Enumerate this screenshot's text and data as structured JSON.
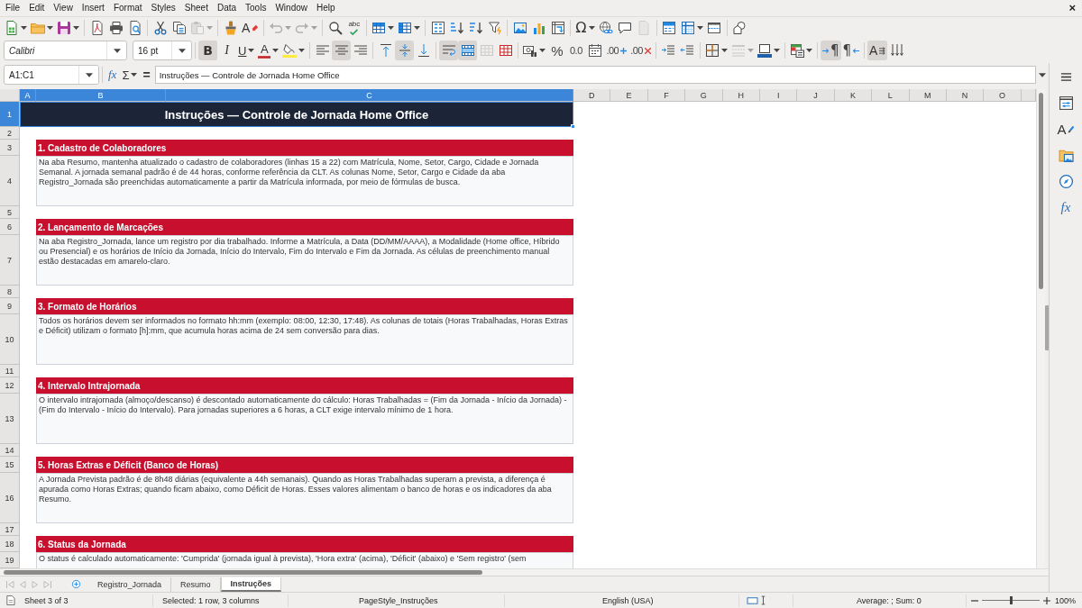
{
  "menu_bar": {
    "items": [
      "File",
      "Edit",
      "View",
      "Insert",
      "Format",
      "Styles",
      "Sheet",
      "Data",
      "Tools",
      "Window",
      "Help"
    ],
    "close_glyph": "×"
  },
  "standard_toolbar": {
    "groups": [
      [
        {
          "dropdown": true,
          "disabled": false
        },
        {
          "dropdown": true,
          "disabled": false
        },
        {
          "dropdown": true,
          "disabled": false
        }
      ],
      [
        {
          "dropdown": false,
          "disabled": false
        },
        {
          "dropdown": false,
          "disabled": false
        },
        {
          "dropdown": false,
          "disabled": false
        }
      ],
      [
        {
          "dropdown": false,
          "disabled": false
        },
        {
          "dropdown": false,
          "disabled": false
        },
        {
          "dropdown": true,
          "disabled": true
        }
      ],
      [
        {
          "dropdown": false,
          "disabled": false
        },
        {
          "glyph": "A",
          "dropdown": false,
          "disabled": false
        }
      ],
      [
        {
          "dropdown": true,
          "disabled": true
        },
        {
          "dropdown": true,
          "disabled": true
        }
      ],
      [
        {
          "dropdown": false,
          "disabled": false
        },
        {
          "glyph": "abc",
          "dropdown": false,
          "disabled": false
        }
      ],
      [
        {
          "dropdown": true,
          "disabled": false
        },
        {
          "dropdown": true,
          "disabled": false
        }
      ],
      [
        {
          "dropdown": false,
          "disabled": false
        },
        {
          "dropdown": false,
          "disabled": false
        },
        {
          "dropdown": false,
          "disabled": false
        },
        {
          "dropdown": false,
          "disabled": false
        }
      ],
      [
        {
          "dropdown": false,
          "disabled": false
        },
        {
          "dropdown": false,
          "disabled": false
        },
        {
          "dropdown": false,
          "disabled": false
        }
      ],
      [
        {
          "glyph": "Ω",
          "dropdown": true,
          "disabled": false
        },
        {
          "dropdown": false,
          "disabled": false
        },
        {
          "dropdown": false,
          "disabled": false
        },
        {
          "dropdown": false,
          "disabled": true
        }
      ],
      [
        {
          "dropdown": false,
          "disabled": false
        },
        {
          "dropdown": true,
          "disabled": false
        },
        {
          "dropdown": false,
          "disabled": false
        }
      ],
      [
        {
          "dropdown": false,
          "disabled": false
        }
      ]
    ]
  },
  "formatting_toolbar": {
    "font_name": "Calibri",
    "font_size": "16 pt",
    "groups": [
      [
        {
          "glyph": "B",
          "pressed": true,
          "dropdown": false,
          "disabled": false
        },
        {
          "glyph": "I",
          "pressed": false,
          "dropdown": false,
          "disabled": false
        },
        {
          "glyph": "U",
          "pressed": false,
          "dropdown": true,
          "disabled": false
        },
        {
          "glyph": "A",
          "pressed": false,
          "dropdown": true,
          "disabled": false
        },
        {
          "pressed": false,
          "dropdown": true,
          "disabled": false
        }
      ],
      [
        {
          "pressed": false,
          "dropdown": false,
          "disabled": false
        },
        {
          "pressed": true,
          "dropdown": false,
          "disabled": false
        },
        {
          "pressed": false,
          "dropdown": false,
          "disabled": false
        }
      ],
      [
        {
          "pressed": false,
          "dropdown": false,
          "disabled": false
        },
        {
          "pressed": true,
          "dropdown": false,
          "disabled": false
        },
        {
          "pressed": false,
          "dropdown": false,
          "disabled": false
        }
      ],
      [
        {
          "pressed": true,
          "dropdown": false,
          "disabled": false
        },
        {
          "pressed": true,
          "dropdown": false,
          "disabled": false
        },
        {
          "pressed": false,
          "dropdown": false,
          "disabled": true
        },
        {
          "pressed": false,
          "dropdown": false,
          "disabled": false
        }
      ],
      [
        {
          "pressed": false,
          "dropdown": true,
          "disabled": false
        },
        {
          "glyph": "%",
          "pressed": false,
          "dropdown": false,
          "disabled": false
        },
        {
          "glyph": "0.0",
          "pressed": false,
          "dropdown": false,
          "disabled": false
        },
        {
          "pressed": false,
          "dropdown": false,
          "disabled": false
        },
        {
          "glyph": ".00",
          "pressed": false,
          "dropdown": false,
          "disabled": false
        },
        {
          "glyph": ".00",
          "pressed": false,
          "dropdown": false,
          "disabled": false
        }
      ],
      [
        {
          "pressed": false,
          "dropdown": false,
          "disabled": false
        },
        {
          "pressed": false,
          "dropdown": false,
          "disabled": false
        }
      ],
      [
        {
          "pressed": false,
          "dropdown": true,
          "disabled": false
        },
        {
          "pressed": false,
          "dropdown": true,
          "disabled": true
        },
        {
          "pressed": false,
          "dropdown": true,
          "disabled": false
        }
      ],
      [
        {
          "pressed": false,
          "dropdown": true,
          "disabled": false
        }
      ],
      [
        {
          "glyph": "¶",
          "pressed": true,
          "dropdown": false,
          "disabled": false
        },
        {
          "glyph": "¶",
          "pressed": false,
          "dropdown": false,
          "disabled": false
        }
      ],
      [
        {
          "glyph": "A",
          "pressed": true,
          "dropdown": false,
          "disabled": false
        },
        {
          "pressed": false,
          "dropdown": false,
          "disabled": false
        }
      ]
    ]
  },
  "formula_bar": {
    "name_box": "A1:C1",
    "function_glyph": "fx",
    "sum_glyph": "Σ",
    "equals_glyph": "=",
    "content": "Instruções — Controle de Jornada Home Office"
  },
  "sidebar": {
    "styles_glyph": "A",
    "functions_glyph": "fx"
  },
  "sheet": {
    "columns": [
      {
        "label": "A",
        "selected": true
      },
      {
        "label": "B",
        "selected": true
      },
      {
        "label": "C",
        "selected": true
      },
      {
        "label": "D",
        "selected": false
      },
      {
        "label": "E",
        "selected": false
      },
      {
        "label": "F",
        "selected": false
      },
      {
        "label": "G",
        "selected": false
      },
      {
        "label": "H",
        "selected": false
      },
      {
        "label": "I",
        "selected": false
      },
      {
        "label": "J",
        "selected": false
      },
      {
        "label": "K",
        "selected": false
      },
      {
        "label": "L",
        "selected": false
      },
      {
        "label": "M",
        "selected": false
      },
      {
        "label": "N",
        "selected": false
      },
      {
        "label": "O",
        "selected": false
      }
    ],
    "rows": [
      {
        "number": "1",
        "selected": true,
        "kind": "title",
        "text": "Instruções — Controle de Jornada Home Office"
      },
      {
        "number": "2",
        "selected": false,
        "kind": "blank"
      },
      {
        "number": "3",
        "selected": false,
        "kind": "heading",
        "text": "1. Cadastro de Colaboradores"
      },
      {
        "number": "4",
        "selected": false,
        "kind": "body",
        "text": "Na aba Resumo, mantenha atualizado o cadastro de colaboradores (linhas 15 a 22) com Matrícula, Nome, Setor, Cargo, Cidade e Jornada Semanal. A jornada semanal padrão é de 44 horas, conforme referência da CLT. As colunas Nome, Setor, Cargo e Cidade da aba Registro_Jornada são preenchidas automaticamente a partir da Matrícula informada, por meio de fórmulas de busca."
      },
      {
        "number": "5",
        "selected": false,
        "kind": "blank"
      },
      {
        "number": "6",
        "selected": false,
        "kind": "heading",
        "text": "2. Lançamento de Marcações"
      },
      {
        "number": "7",
        "selected": false,
        "kind": "body",
        "text": "Na aba Registro_Jornada, lance um registro por dia trabalhado. Informe a Matrícula, a Data (DD/MM/AAAA), a Modalidade (Home office, Híbrido ou Presencial) e os horários de Início da Jornada, Início do Intervalo, Fim do Intervalo e Fim da Jornada. As células de preenchimento manual estão destacadas em amarelo-claro."
      },
      {
        "number": "8",
        "selected": false,
        "kind": "blank"
      },
      {
        "number": "9",
        "selected": false,
        "kind": "heading",
        "text": "3. Formato de Horários"
      },
      {
        "number": "10",
        "selected": false,
        "kind": "body",
        "text": "Todos os horários devem ser informados no formato hh:mm (exemplo: 08:00, 12:30, 17:48). As colunas de totais (Horas Trabalhadas, Horas Extras e Déficit) utilizam o formato [h]:mm, que acumula horas acima de 24 sem conversão para dias."
      },
      {
        "number": "11",
        "selected": false,
        "kind": "blank"
      },
      {
        "number": "12",
        "selected": false,
        "kind": "heading",
        "text": "4. Intervalo Intrajornada"
      },
      {
        "number": "13",
        "selected": false,
        "kind": "body",
        "text": "O intervalo intrajornada (almoço/descanso) é descontado automaticamente do cálculo: Horas Trabalhadas = (Fim da Jornada - Início da Jornada) - (Fim do Intervalo - Início do Intervalo). Para jornadas superiores a 6 horas, a CLT exige intervalo mínimo de 1 hora."
      },
      {
        "number": "14",
        "selected": false,
        "kind": "blank"
      },
      {
        "number": "15",
        "selected": false,
        "kind": "heading",
        "text": "5. Horas Extras e Déficit (Banco de Horas)"
      },
      {
        "number": "16",
        "selected": false,
        "kind": "body",
        "text": "A Jornada Prevista padrão é de 8h48 diárias (equivalente a 44h semanais). Quando as Horas Trabalhadas superam a prevista, a diferença é apurada como Horas Extras; quando ficam abaixo, como Déficit de Horas. Esses valores alimentam o banco de horas e os indicadores da aba Resumo."
      },
      {
        "number": "17",
        "selected": false,
        "kind": "blank"
      },
      {
        "number": "18",
        "selected": false,
        "kind": "heading",
        "text": "6. Status da Jornada"
      },
      {
        "number": "19",
        "selected": false,
        "kind": "body",
        "text": "O status é calculado automaticamente: 'Cumprida' (jornada igual à prevista), 'Hora extra' (acima), 'Déficit' (abaixo) e 'Sem registro' (sem"
      }
    ]
  },
  "sheet_tabs": {
    "navigation": [
      {
        "disabled": true
      },
      {
        "disabled": true
      },
      {
        "disabled": true
      },
      {
        "disabled": true
      }
    ],
    "tabs": [
      {
        "label": "Registro_Jornada",
        "selected": false
      },
      {
        "label": "Resumo",
        "selected": false
      },
      {
        "label": "Instruções",
        "selected": true
      }
    ]
  },
  "status_bar": {
    "sheet": "Sheet 3 of 3",
    "selection": "Selected: 1 row, 3 columns",
    "page_style": "PageStyle_Instruções",
    "language": "English (USA)",
    "summary": "Average: ; Sum: 0",
    "zoom_slider": {
      "level": 0.5
    },
    "zoom": "100%"
  }
}
